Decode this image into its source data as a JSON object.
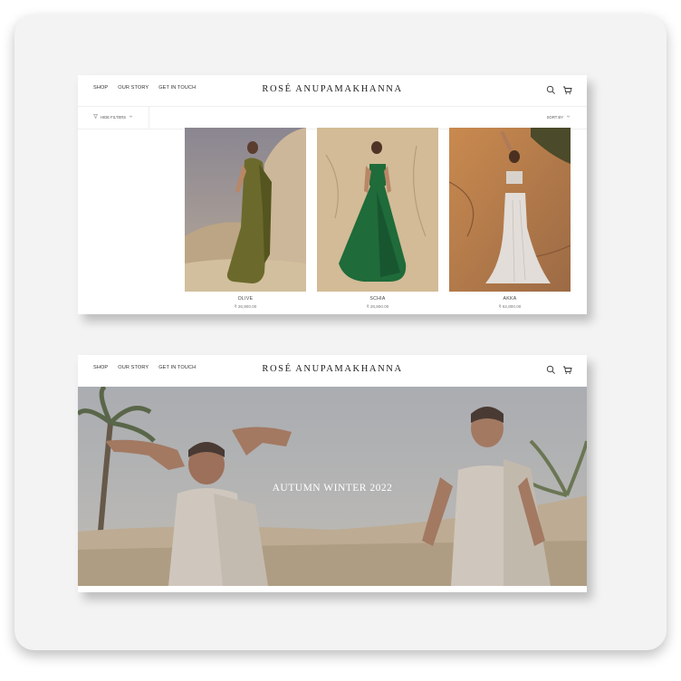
{
  "brand": "ROSÉ ANUPAMAKHANNA",
  "nav": [
    "SHOP",
    "OUR STORY",
    "GET IN TOUCH"
  ],
  "icons": [
    "search-icon",
    "cart-icon",
    "filter-icon",
    "chevron-down-icon"
  ],
  "listing": {
    "filter_label": "HIDE FILTERS",
    "sort_label": "SORT BY",
    "products": [
      {
        "name": "OLIVE",
        "price": "₹ 26,900.00"
      },
      {
        "name": "SCHIA",
        "price": "₹ 28,800.00"
      },
      {
        "name": "AKKA",
        "price": "₹ 62,800.00"
      }
    ]
  },
  "hero": {
    "title": "AUTUMN WINTER 2022"
  },
  "colors": {
    "card_bg": "#f3f3f3",
    "text": "#222222",
    "olive": "#6b6a2c",
    "emerald": "#1f6b3a",
    "sand": "#d9c3a0"
  }
}
